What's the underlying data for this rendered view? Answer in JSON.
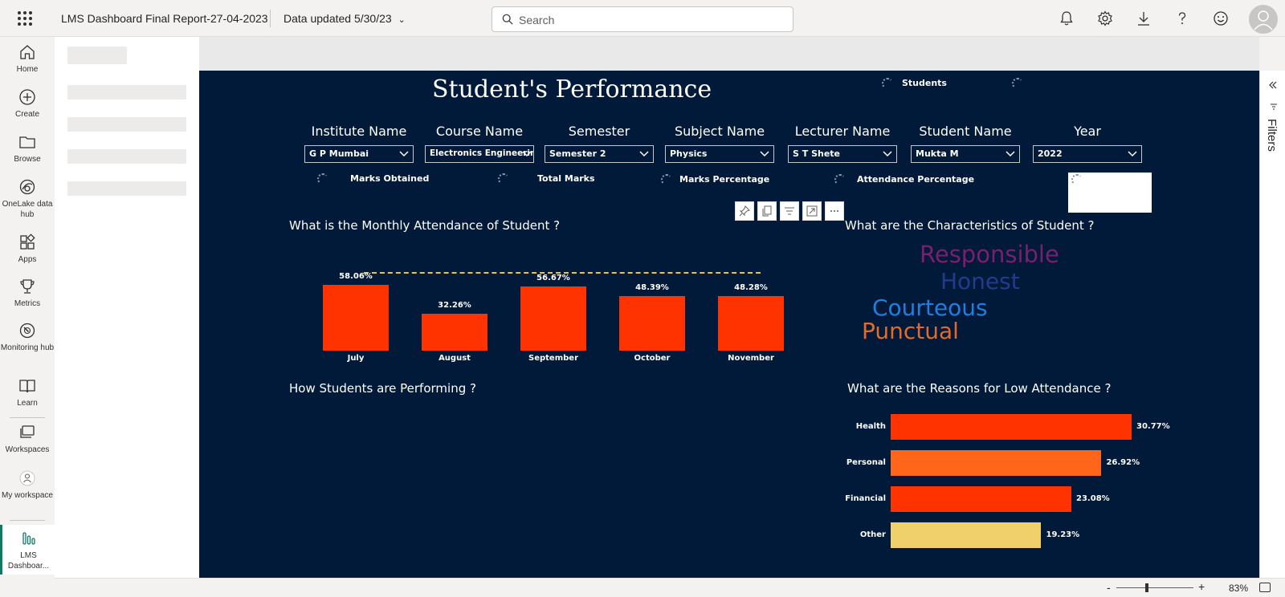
{
  "app": {
    "report_title": "LMS Dashboard Final Report-27-04-2023",
    "data_updated": "Data updated 5/30/23",
    "search_placeholder": "Search"
  },
  "nav": {
    "items": [
      {
        "label": "Home",
        "icon": "home-icon"
      },
      {
        "label": "Create",
        "icon": "plus-circle-icon"
      },
      {
        "label": "Browse",
        "icon": "folder-icon"
      },
      {
        "label": "OneLake data hub",
        "icon": "onelake-icon"
      },
      {
        "label": "Apps",
        "icon": "apps-icon"
      },
      {
        "label": "Metrics",
        "icon": "trophy-icon"
      },
      {
        "label": "Monitoring hub",
        "icon": "monitoring-icon"
      },
      {
        "label": "Learn",
        "icon": "book-icon"
      },
      {
        "label": "Workspaces",
        "icon": "workspaces-icon"
      },
      {
        "label": "My workspace",
        "icon": "person-icon"
      },
      {
        "label": "LMS Dashboar...",
        "icon": "report-bars-icon"
      }
    ]
  },
  "report": {
    "heading": "Student's Performance",
    "students_label": "Students",
    "cards": {
      "marks_obtained": "Marks Obtained",
      "total_marks": "Total Marks",
      "marks_percentage": "Marks Percentage",
      "attendance_percentage": "Attendance Percentage"
    },
    "slicers": [
      {
        "title": "Institute Name",
        "value": "G P Mumbai"
      },
      {
        "title": "Course Name",
        "value": "Electronics Engineering"
      },
      {
        "title": "Semester",
        "value": "Semester 2"
      },
      {
        "title": "Subject Name",
        "value": "Physics"
      },
      {
        "title": "Lecturer Name",
        "value": "S T Shete"
      },
      {
        "title": "Student Name",
        "value": "Mukta M"
      },
      {
        "title": "Year",
        "value": "2022"
      }
    ],
    "monthly_title": "What is the Monthly Attendance of Student ?",
    "characteristics_title": "What are the Characteristics of Student ?",
    "performing_title": "How Students are Performing ?",
    "reasons_title": "What are the Reasons for Low Attendance ?",
    "words": [
      {
        "text": "Responsible",
        "color": "#7a1f6e"
      },
      {
        "text": "Honest",
        "color": "#243a8c"
      },
      {
        "text": "Courteous",
        "color": "#1f7fe0"
      },
      {
        "text": "Punctual",
        "color": "#e36a2a"
      }
    ]
  },
  "chart_data": [
    {
      "type": "bar",
      "title": "What is the Monthly Attendance of Student ?",
      "categories": [
        "July",
        "August",
        "September",
        "October",
        "November"
      ],
      "values": [
        58.06,
        32.26,
        56.67,
        48.39,
        48.28
      ],
      "data_labels": [
        "58.06%",
        "32.26%",
        "56.67%",
        "48.39%",
        "48.28%"
      ],
      "bar_color": "#ff3300",
      "reference_line": {
        "style": "dashed",
        "color": "#f2c811"
      },
      "ylim": [
        0,
        58.06
      ]
    },
    {
      "type": "bar",
      "orientation": "horizontal",
      "title": "What are the Reasons for Low Attendance ?",
      "categories": [
        "Health",
        "Personal",
        "Financial",
        "Other"
      ],
      "values": [
        30.77,
        26.92,
        23.08,
        19.23
      ],
      "data_labels": [
        "30.77%",
        "26.92%",
        "23.08%",
        "19.23%"
      ],
      "colors": [
        "#ff3300",
        "#ff661a",
        "#ff3300",
        "#f0d06a"
      ],
      "xlim": [
        0,
        30.77
      ]
    }
  ],
  "statusbar": {
    "zoom_minus": "-",
    "zoom_plus": "+",
    "zoom_level": "83%",
    "zoom_fraction": 0.4
  },
  "filters": {
    "label": "Filters"
  }
}
